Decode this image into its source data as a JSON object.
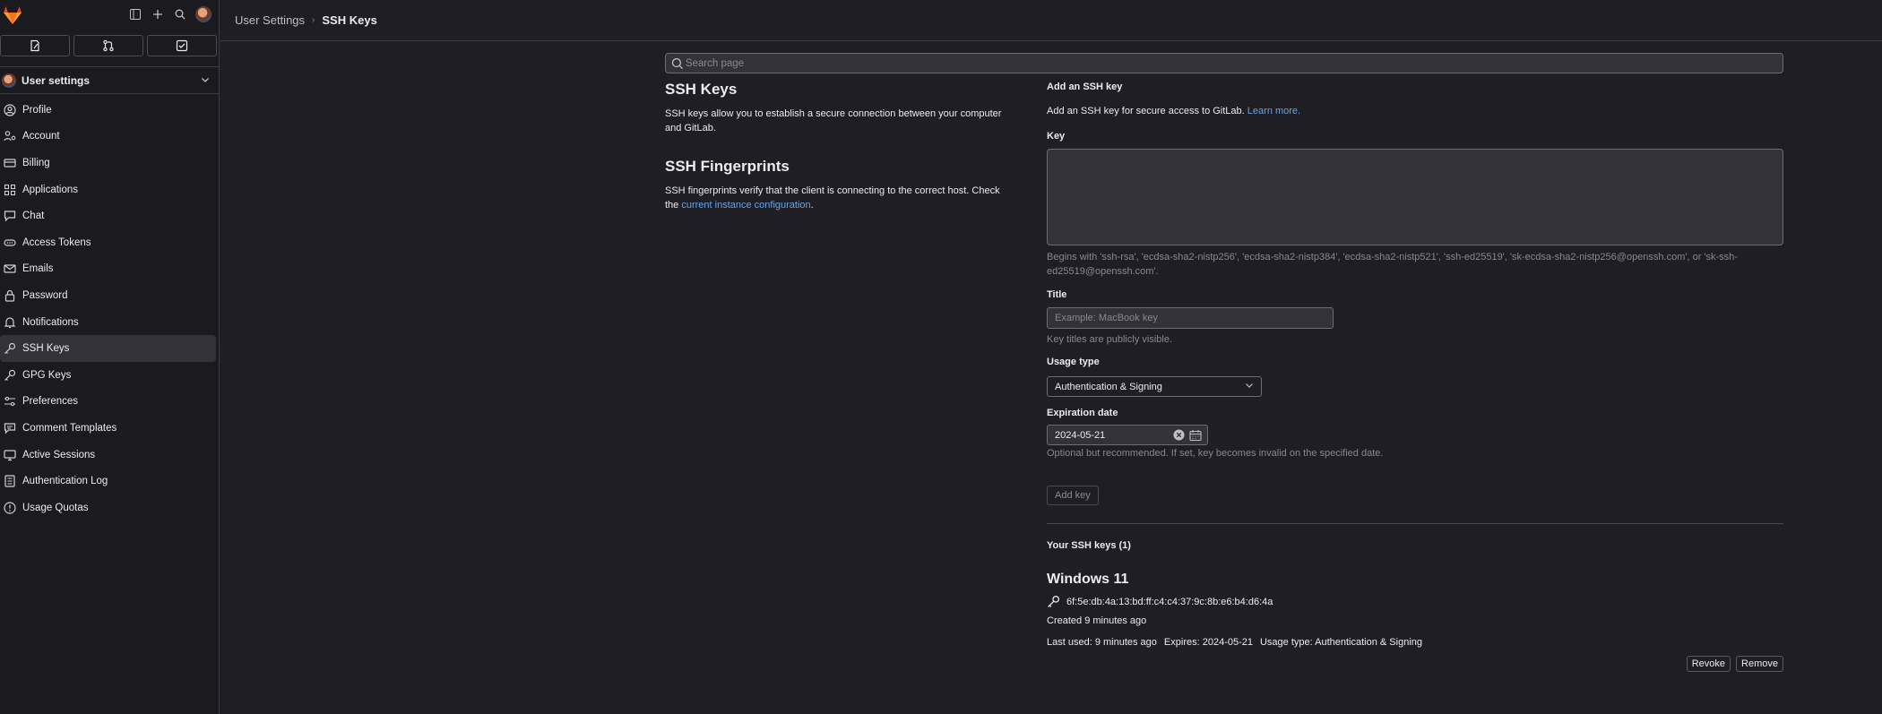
{
  "sidebar": {
    "section_title": "User settings",
    "items": [
      {
        "label": "Profile",
        "icon": "profile-icon"
      },
      {
        "label": "Account",
        "icon": "account-icon"
      },
      {
        "label": "Billing",
        "icon": "billing-icon"
      },
      {
        "label": "Applications",
        "icon": "applications-icon"
      },
      {
        "label": "Chat",
        "icon": "chat-icon"
      },
      {
        "label": "Access Tokens",
        "icon": "token-icon"
      },
      {
        "label": "Emails",
        "icon": "mail-icon"
      },
      {
        "label": "Password",
        "icon": "lock-icon"
      },
      {
        "label": "Notifications",
        "icon": "bell-icon"
      },
      {
        "label": "SSH Keys",
        "icon": "key-icon"
      },
      {
        "label": "GPG Keys",
        "icon": "key-icon"
      },
      {
        "label": "Preferences",
        "icon": "preferences-icon"
      },
      {
        "label": "Comment Templates",
        "icon": "comment-icon"
      },
      {
        "label": "Active Sessions",
        "icon": "monitor-icon"
      },
      {
        "label": "Authentication Log",
        "icon": "log-icon"
      },
      {
        "label": "Usage Quotas",
        "icon": "quota-icon"
      }
    ],
    "active_index": 9
  },
  "breadcrumb": {
    "parent": "User Settings",
    "separator": "›",
    "current": "SSH Keys"
  },
  "search": {
    "placeholder": "Search page"
  },
  "left": {
    "ssh_title": "SSH Keys",
    "ssh_desc": "SSH keys allow you to establish a secure connection between your computer and GitLab.",
    "fp_title": "SSH Fingerprints",
    "fp_desc_before": "SSH fingerprints verify that the client is connecting to the correct host. Check the ",
    "fp_link": "current instance configuration",
    "fp_desc_after": "."
  },
  "form": {
    "heading": "Add an SSH key",
    "intro": "Add an SSH key for secure access to GitLab.",
    "learn_more": "Learn more.",
    "key_label": "Key",
    "key_help": "Begins with 'ssh-rsa', 'ecdsa-sha2-nistp256', 'ecdsa-sha2-nistp384', 'ecdsa-sha2-nistp521', 'ssh-ed25519', 'sk-ecdsa-sha2-nistp256@openssh.com', or 'sk-ssh-ed25519@openssh.com'.",
    "title_label": "Title",
    "title_placeholder": "Example: MacBook key",
    "title_help": "Key titles are publicly visible.",
    "usage_label": "Usage type",
    "usage_value": "Authentication & Signing",
    "exp_label": "Expiration date",
    "exp_value": "2024-05-21",
    "exp_help": "Optional but recommended. If set, key becomes invalid on the specified date.",
    "add_button": "Add key"
  },
  "keys": {
    "heading": "Your SSH keys (1)",
    "items": [
      {
        "title": "Windows 11",
        "fingerprint": "6f:5e:db:4a:13:bd:ff:c4:c4:37:9c:8b:e6:b4:d6:4a",
        "created": "Created 9 minutes ago",
        "last_used": "Last used: 9 minutes ago",
        "expires": "Expires: 2024-05-21",
        "usage": "Usage type: Authentication & Signing",
        "revoke": "Revoke",
        "remove": "Remove"
      }
    ]
  },
  "colors": {
    "accent_link": "#63a6e9",
    "background": "#1f1e24",
    "sidebar": "#1a1a1f",
    "logo": "#e24329"
  }
}
